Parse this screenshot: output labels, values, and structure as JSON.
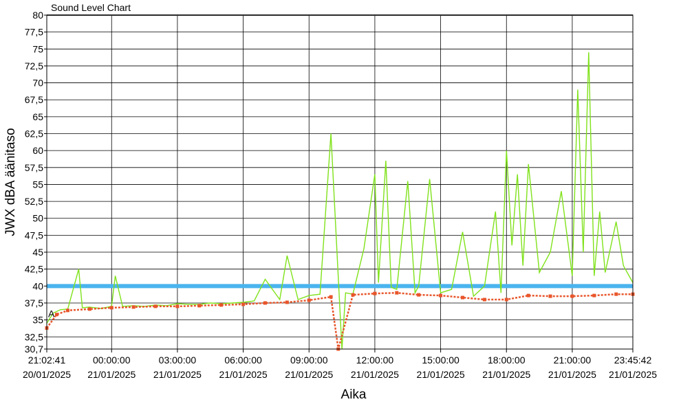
{
  "chart_data": {
    "type": "line",
    "title": "Sound Level Chart",
    "xlabel": "Aika",
    "ylabel": "JWX dBA äänitaso",
    "ylim": [
      30.7,
      80
    ],
    "y_ticks": [
      "30,7",
      "32,5",
      "35",
      "37,5",
      "40",
      "42,5",
      "45",
      "47,5",
      "50",
      "52,5",
      "55",
      "57,5",
      "60",
      "62,5",
      "65",
      "67,5",
      "70",
      "72,5",
      "75",
      "77,5",
      "80"
    ],
    "x_ticks": [
      {
        "time": "21:02:41",
        "date": "20/01/2025"
      },
      {
        "time": "00:00:00",
        "date": "21/01/2025"
      },
      {
        "time": "03:00:00",
        "date": "21/01/2025"
      },
      {
        "time": "06:00:00",
        "date": "21/01/2025"
      },
      {
        "time": "09:00:00",
        "date": "21/01/2025"
      },
      {
        "time": "12:00:00",
        "date": "21/01/2025"
      },
      {
        "time": "15:00:00",
        "date": "21/01/2025"
      },
      {
        "time": "18:00:00",
        "date": "21/01/2025"
      },
      {
        "time": "21:00:00",
        "date": "21/01/2025"
      },
      {
        "time": "23:45:42",
        "date": "21/01/2025"
      }
    ],
    "x_start": "2025-01-20T21:02:41",
    "x_end": "2025-01-21T23:45:42",
    "reference_line": {
      "value": 40,
      "color": "#4ab4ee"
    },
    "marker_label": "A",
    "series": [
      {
        "color": "#7fe21a",
        "style": "line",
        "x": [
          "2025-01-20T21:02:41",
          "2025-01-20T21:20:00",
          "2025-01-20T21:40:00",
          "2025-01-20T22:00:00",
          "2025-01-20T22:30:00",
          "2025-01-20T22:40:00",
          "2025-01-20T23:00:00",
          "2025-01-20T23:30:00",
          "2025-01-21T00:00:00",
          "2025-01-21T00:10:00",
          "2025-01-21T00:30:00",
          "2025-01-21T01:00:00",
          "2025-01-21T01:30:00",
          "2025-01-21T02:00:00",
          "2025-01-21T02:30:00",
          "2025-01-21T03:00:00",
          "2025-01-21T03:30:00",
          "2025-01-21T04:00:00",
          "2025-01-21T04:30:00",
          "2025-01-21T05:00:00",
          "2025-01-21T05:30:00",
          "2025-01-21T06:00:00",
          "2025-01-21T06:30:00",
          "2025-01-21T07:00:00",
          "2025-01-21T07:40:00",
          "2025-01-21T08:00:00",
          "2025-01-21T08:30:00",
          "2025-01-21T09:00:00",
          "2025-01-21T09:30:00",
          "2025-01-21T10:00:00",
          "2025-01-21T10:30:00",
          "2025-01-21T10:40:00",
          "2025-01-21T11:00:00",
          "2025-01-21T11:30:00",
          "2025-01-21T12:00:00",
          "2025-01-21T12:10:00",
          "2025-01-21T12:30:00",
          "2025-01-21T12:45:00",
          "2025-01-21T13:00:00",
          "2025-01-21T13:30:00",
          "2025-01-21T13:50:00",
          "2025-01-21T14:00:00",
          "2025-01-21T14:30:00",
          "2025-01-21T15:00:00",
          "2025-01-21T15:30:00",
          "2025-01-21T16:00:00",
          "2025-01-21T16:30:00",
          "2025-01-21T17:00:00",
          "2025-01-21T17:30:00",
          "2025-01-21T17:45:00",
          "2025-01-21T18:00:00",
          "2025-01-21T18:15:00",
          "2025-01-21T18:30:00",
          "2025-01-21T18:45:00",
          "2025-01-21T19:00:00",
          "2025-01-21T19:30:00",
          "2025-01-21T20:00:00",
          "2025-01-21T20:30:00",
          "2025-01-21T21:00:00",
          "2025-01-21T21:15:00",
          "2025-01-21T21:30:00",
          "2025-01-21T21:45:00",
          "2025-01-21T22:00:00",
          "2025-01-21T22:15:00",
          "2025-01-21T22:30:00",
          "2025-01-21T23:00:00",
          "2025-01-21T23:20:00",
          "2025-01-21T23:45:42"
        ],
        "y": [
          34.5,
          36.0,
          36.5,
          36.6,
          42.5,
          36.8,
          36.9,
          36.7,
          37.0,
          41.5,
          37.0,
          37.1,
          37.0,
          37.2,
          37.1,
          37.4,
          37.3,
          37.3,
          37.5,
          37.4,
          37.5,
          37.6,
          37.8,
          41.0,
          38.0,
          44.5,
          38.0,
          38.6,
          38.8,
          62.5,
          30.7,
          39.0,
          38.8,
          45.5,
          56.5,
          40.5,
          58.5,
          39.8,
          39.5,
          55.5,
          39.0,
          40.0,
          55.8,
          39.0,
          39.5,
          48.0,
          38.5,
          40.0,
          51.0,
          39.0,
          60.0,
          46.0,
          56.5,
          43.0,
          58.0,
          42.0,
          45.0,
          54.0,
          41.5,
          69.0,
          45.0,
          74.5,
          41.5,
          51.0,
          42.0,
          49.5,
          43.0,
          40.5
        ]
      },
      {
        "color": "#e8552a",
        "style": "markers",
        "x": [
          "2025-01-20T21:02:41",
          "2025-01-20T21:30:00",
          "2025-01-20T22:00:00",
          "2025-01-20T23:00:00",
          "2025-01-21T00:00:00",
          "2025-01-21T01:00:00",
          "2025-01-21T02:00:00",
          "2025-01-21T03:00:00",
          "2025-01-21T04:00:00",
          "2025-01-21T05:00:00",
          "2025-01-21T06:00:00",
          "2025-01-21T07:00:00",
          "2025-01-21T08:00:00",
          "2025-01-21T09:00:00",
          "2025-01-21T10:00:00",
          "2025-01-21T10:20:00",
          "2025-01-21T11:00:00",
          "2025-01-21T12:00:00",
          "2025-01-21T13:00:00",
          "2025-01-21T14:00:00",
          "2025-01-21T15:00:00",
          "2025-01-21T16:00:00",
          "2025-01-21T17:00:00",
          "2025-01-21T18:00:00",
          "2025-01-21T19:00:00",
          "2025-01-21T20:00:00",
          "2025-01-21T21:00:00",
          "2025-01-21T22:00:00",
          "2025-01-21T23:00:00",
          "2025-01-21T23:45:42"
        ],
        "y": [
          33.8,
          35.8,
          36.4,
          36.6,
          36.8,
          36.9,
          37.0,
          37.0,
          37.1,
          37.2,
          37.3,
          37.5,
          37.6,
          37.9,
          38.4,
          30.7,
          38.7,
          38.9,
          39.0,
          38.7,
          38.6,
          38.3,
          38.0,
          38.0,
          38.6,
          38.5,
          38.5,
          38.6,
          38.8,
          38.8
        ]
      }
    ]
  }
}
